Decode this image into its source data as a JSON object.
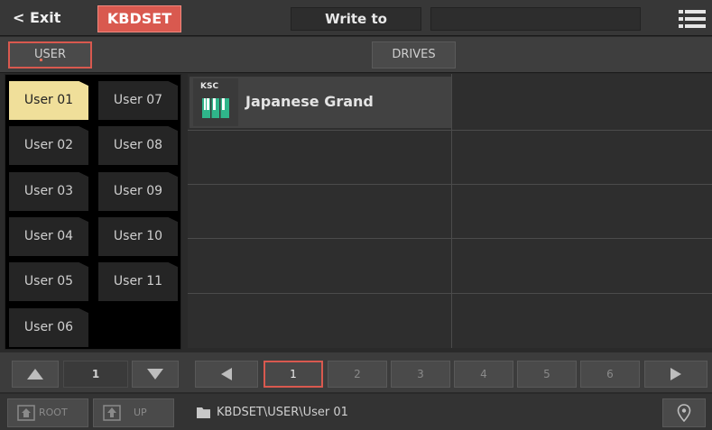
{
  "topbar": {
    "exit_label": "< Exit",
    "mode_label": "KBDSET",
    "write_label": "Write to",
    "menu_icon": "hamburger-menu-icon"
  },
  "sources": {
    "user_label": "USER",
    "drives_label": "DRIVES"
  },
  "folders": [
    {
      "label": "User 01",
      "selected": true
    },
    {
      "label": "User 02",
      "selected": false
    },
    {
      "label": "User 03",
      "selected": false
    },
    {
      "label": "User 04",
      "selected": false
    },
    {
      "label": "User 05",
      "selected": false
    },
    {
      "label": "User 06",
      "selected": false
    },
    {
      "label": "User 07",
      "selected": false
    },
    {
      "label": "User 08",
      "selected": false
    },
    {
      "label": "User 09",
      "selected": false
    },
    {
      "label": "User 10",
      "selected": false
    },
    {
      "label": "User 11",
      "selected": false
    }
  ],
  "entries": [
    {
      "badge": "KSC",
      "name": "Japanese Grand",
      "icon": "piano-keys-icon"
    }
  ],
  "folder_pager": {
    "page": "1"
  },
  "pager": {
    "pages": [
      "1",
      "2",
      "3",
      "4",
      "5",
      "6"
    ],
    "current": "1"
  },
  "footer": {
    "root_label": "ROOT",
    "up_label": "UP",
    "path": "KBDSET\\USER\\User 01"
  },
  "colors": {
    "accent": "#d9594f",
    "selected_folder": "#f0df9a",
    "piano_icon": "#2fb58a"
  }
}
